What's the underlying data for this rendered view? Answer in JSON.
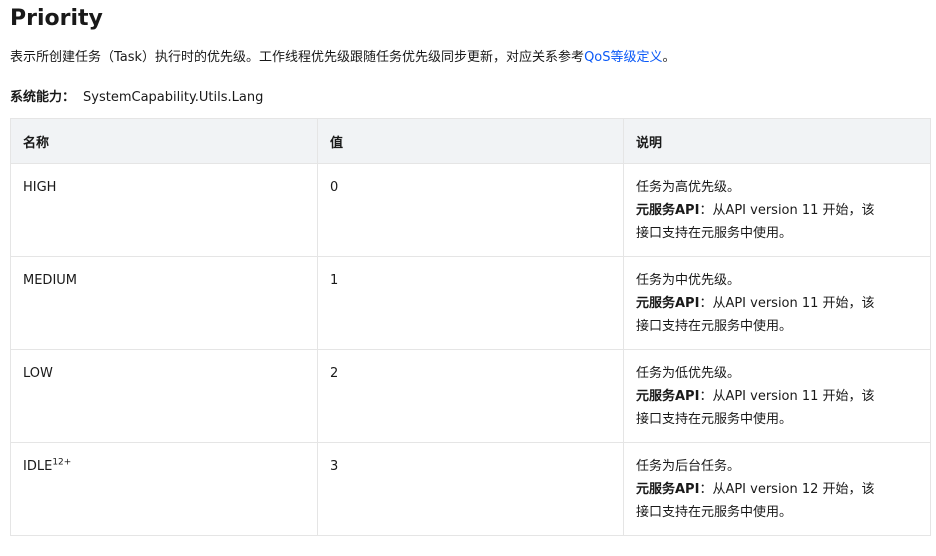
{
  "title": "Priority",
  "description": {
    "text": "表示所创建任务（Task）执行时的优先级。工作线程优先级跟随任务优先级同步更新，对应关系参考",
    "link": "QoS等级定义",
    "end": "。"
  },
  "syscap": {
    "label": "系统能力：",
    "value": "SystemCapability.Utils.Lang"
  },
  "table": {
    "headers": [
      "名称",
      "值",
      "说明"
    ],
    "rows": [
      {
        "name": "HIGH",
        "sup": "",
        "value": "0",
        "desc": "任务为高优先级。",
        "api_label": "元服务API",
        "api_line1": "：从API version 11 开始，该",
        "api_line2": "接口支持在元服务中使用。"
      },
      {
        "name": "MEDIUM",
        "sup": "",
        "value": "1",
        "desc": "任务为中优先级。",
        "api_label": "元服务API",
        "api_line1": "：从API version 11 开始，该",
        "api_line2": "接口支持在元服务中使用。"
      },
      {
        "name": "LOW",
        "sup": "",
        "value": "2",
        "desc": "任务为低优先级。",
        "api_label": "元服务API",
        "api_line1": "：从API version 11 开始，该",
        "api_line2": "接口支持在元服务中使用。"
      },
      {
        "name": "IDLE",
        "sup": "12+",
        "value": "3",
        "desc": "任务为后台任务。",
        "api_label": "元服务API",
        "api_line1": "：从API version 12 开始，该",
        "api_line2": "接口支持在元服务中使用。"
      }
    ]
  }
}
